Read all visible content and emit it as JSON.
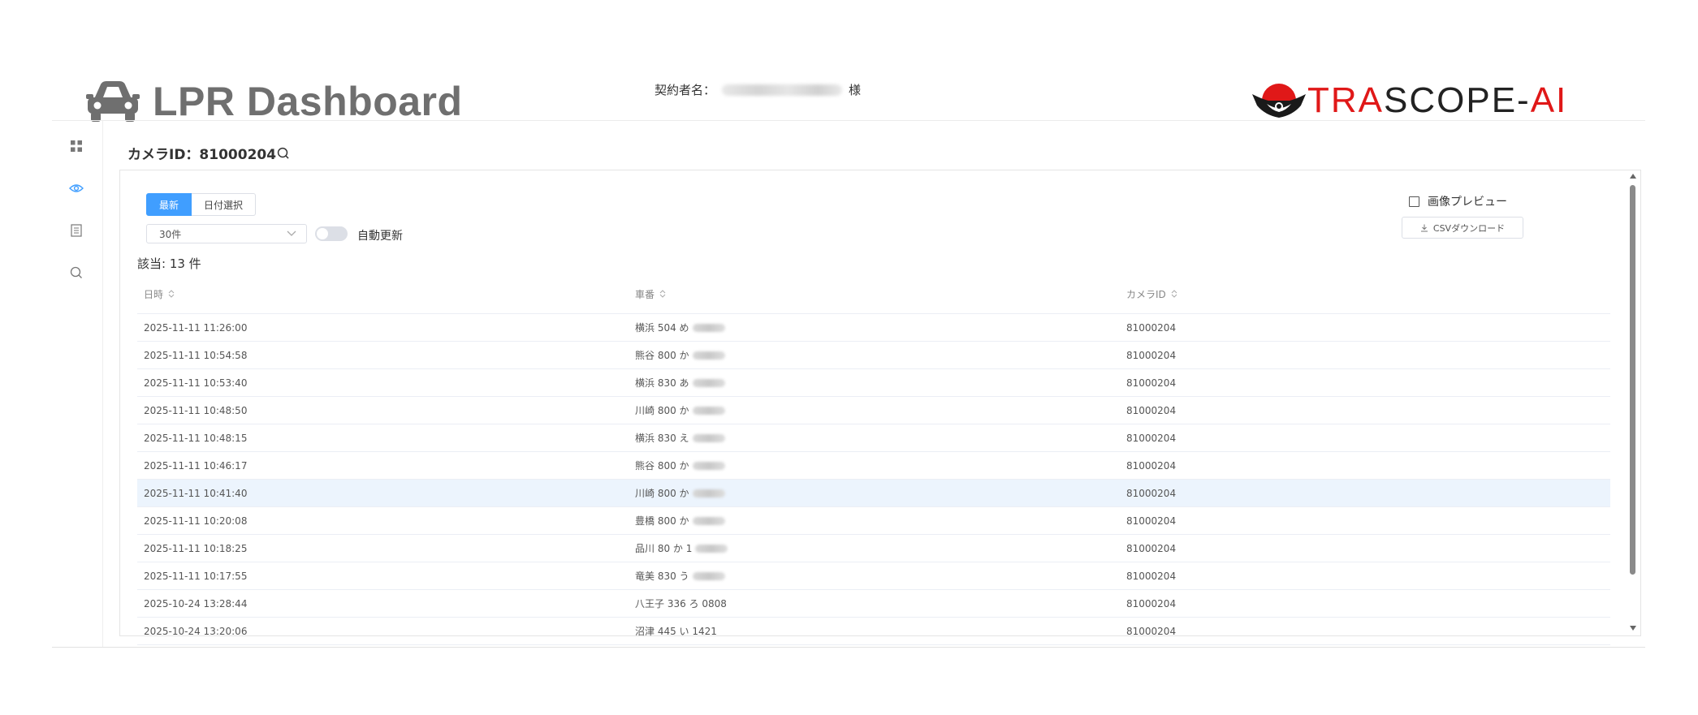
{
  "header": {
    "app_title": "LPR Dashboard",
    "contractor_label": "契約者名：",
    "contractor_suffix": "様",
    "logo": {
      "part1": "TRA",
      "part2": "SCOPE",
      "part3": "-",
      "part4": "AI"
    }
  },
  "sidebar": {
    "items": [
      {
        "icon": "grid-icon",
        "active": false
      },
      {
        "icon": "eye-icon",
        "active": true
      },
      {
        "icon": "document-icon",
        "active": false
      },
      {
        "icon": "search-icon",
        "active": false
      }
    ]
  },
  "camera": {
    "title": "カメラID：81000204"
  },
  "controls": {
    "tabs": [
      "最新",
      "日付選択"
    ],
    "page_size": "30件",
    "auto_refresh_label": "自動更新",
    "auto_refresh_on": false,
    "image_preview_label": "画像プレビュー",
    "csv_download_label": "CSVダウンロード"
  },
  "results": {
    "count_label": "該当: 13 件"
  },
  "table": {
    "columns": [
      "日時",
      "車番",
      "カメラID"
    ],
    "rows": [
      {
        "datetime": "2025-11-11 11:26:00",
        "plate": "横浜 504 め",
        "camera_id": "81000204"
      },
      {
        "datetime": "2025-11-11 10:54:58",
        "plate": "熊谷 800 か",
        "camera_id": "81000204"
      },
      {
        "datetime": "2025-11-11 10:53:40",
        "plate": "横浜 830 あ",
        "camera_id": "81000204"
      },
      {
        "datetime": "2025-11-11 10:48:50",
        "plate": "川崎 800 か",
        "camera_id": "81000204"
      },
      {
        "datetime": "2025-11-11 10:48:15",
        "plate": "横浜 830 え",
        "camera_id": "81000204"
      },
      {
        "datetime": "2025-11-11 10:46:17",
        "plate": "熊谷 800 か",
        "camera_id": "81000204"
      },
      {
        "datetime": "2025-11-11 10:41:40",
        "plate": "川崎 800 か",
        "camera_id": "81000204"
      },
      {
        "datetime": "2025-11-11 10:20:08",
        "plate": "豊橋 800 か",
        "camera_id": "81000204"
      },
      {
        "datetime": "2025-11-11 10:18:25",
        "plate": "品川 80 か 1",
        "camera_id": "81000204"
      },
      {
        "datetime": "2025-11-11 10:17:55",
        "plate": "竜美 830 う",
        "camera_id": "81000204"
      },
      {
        "datetime": "2025-10-24 13:28:44",
        "plate": "八王子 336 ろ 0808",
        "camera_id": "81000204"
      },
      {
        "datetime": "2025-10-24 13:20:06",
        "plate": "沼津 445 い 1421",
        "camera_id": "81000204"
      }
    ],
    "highlighted_row": 6
  },
  "colors": {
    "primary": "#409eff",
    "logo_red": "#e01818",
    "row_highlight": "#ecf4fd"
  }
}
